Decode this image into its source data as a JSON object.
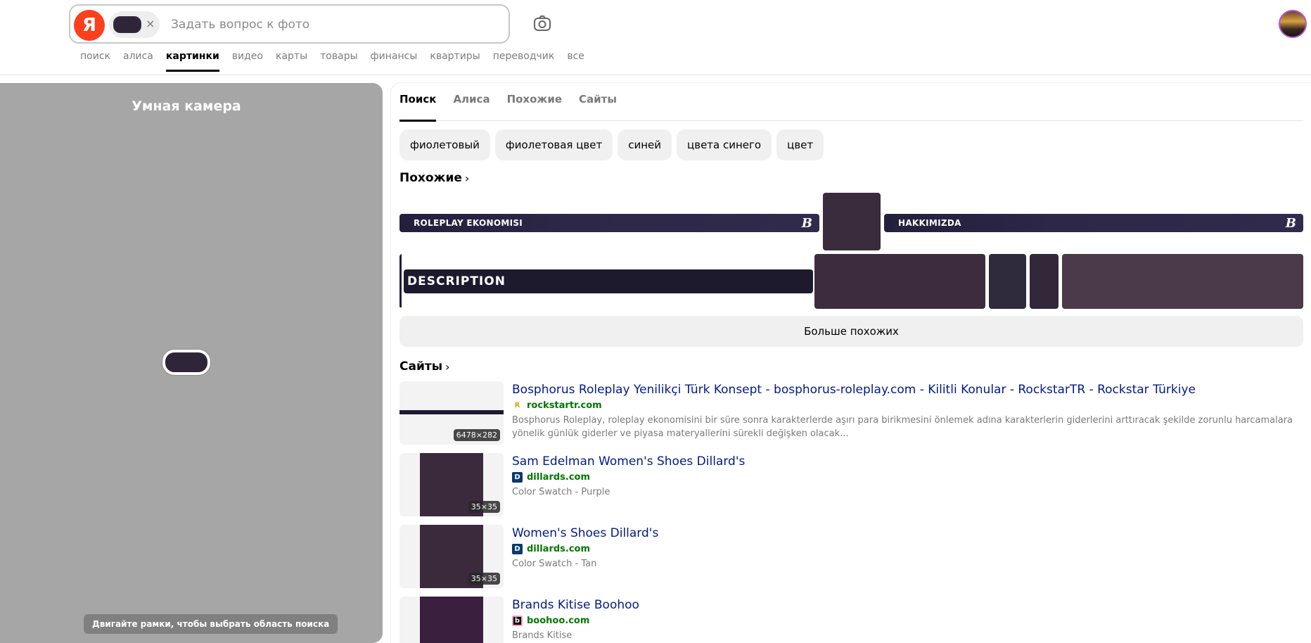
{
  "search": {
    "logo": "Я",
    "placeholder": "Задать вопрос к фото",
    "clear": "×"
  },
  "nav": [
    "поиск",
    "алиса",
    "картинки",
    "видео",
    "карты",
    "товары",
    "финансы",
    "квартиры",
    "переводчик",
    "все"
  ],
  "camera": {
    "title": "Умная камера",
    "hint": "Двигайте рамки, чтобы выбрать область поиска"
  },
  "tabs": [
    "Поиск",
    "Алиса",
    "Похожие",
    "Сайты"
  ],
  "tags": [
    "фиолетовый",
    "фиолетовая цвет",
    "синей",
    "цвета синего",
    "цвет"
  ],
  "similar": {
    "title": "Похожие",
    "chevron": "›",
    "banner1": "ROLEPLAY EKONOMISI",
    "banner2": "HAKKIMIZDA",
    "banner_icon": "B",
    "description": "DESCRIPTION",
    "more": "Больше похожих"
  },
  "sites": {
    "title": "Сайты",
    "chevron": "›",
    "items": [
      {
        "title": "Bosphorus Roleplay Yenilikçi Türk Konsept - bosphorus-roleplay.com - Kilitli Konular - RockstarTR - Rockstar Türkiye",
        "domain": "rockstartr.com",
        "favicon": "R",
        "desc": "Bosphorus Roleplay, roleplay ekonomisini bir süre sonra karakterlerde aşırı para birikmesini önlemek adına karakterlerin giderlerini arttıracak şekilde zorunlu harcamalara yönelik günlük giderler ve piyasa materyallerini sürekli değişken olacak...",
        "dims": "6478×282"
      },
      {
        "title": "Sam Edelman Women's Shoes Dillard's",
        "domain": "dillards.com",
        "favicon": "D",
        "desc": "Color Swatch - Purple",
        "dims": "35×35"
      },
      {
        "title": "Women's Shoes Dillard's",
        "domain": "dillards.com",
        "favicon": "D",
        "desc": "Color Swatch - Tan",
        "dims": "35×35"
      },
      {
        "title": "Brands Kitise Boohoo",
        "domain": "boohoo.com",
        "favicon": "b",
        "desc": "Brands Kitise",
        "dims": ""
      }
    ]
  },
  "colors": {
    "logo": "#fc3f1d",
    "link": "#001a8a",
    "domain": "#007700",
    "swatch": "#3a2b3d"
  }
}
